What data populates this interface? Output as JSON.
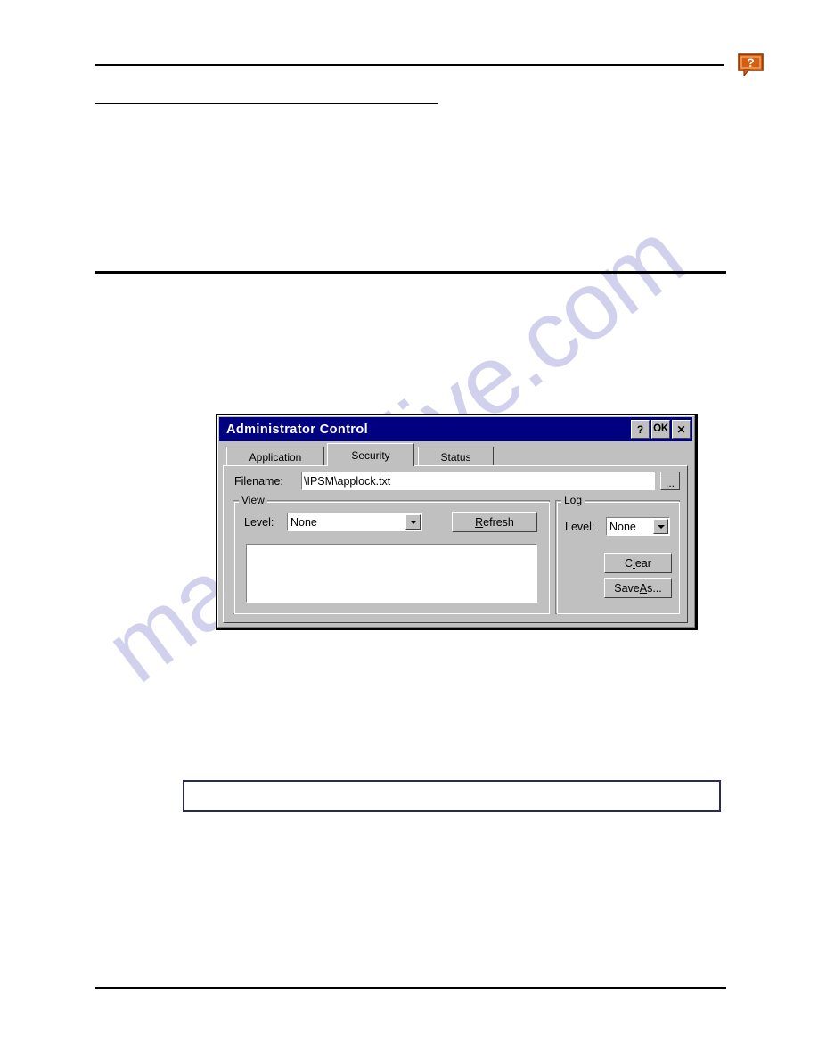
{
  "page": {
    "watermark_text": "manualslive.com",
    "help_icon": "question-mark-bubble-icon",
    "note_box_text": ""
  },
  "dialog": {
    "title": "Administrator Control",
    "titlebar_buttons": [
      {
        "name": "help",
        "label": "?"
      },
      {
        "name": "ok",
        "label": "OK"
      },
      {
        "name": "close",
        "label": "✕"
      }
    ],
    "tabs": [
      {
        "id": "application",
        "label": "Application",
        "active": false
      },
      {
        "id": "security",
        "label": "Security",
        "active": true
      },
      {
        "id": "status",
        "label": "Status",
        "active": false
      }
    ],
    "security_tab": {
      "filename": {
        "label": "Filename:",
        "value": "\\IPSM\\applock.txt",
        "placeholder": "",
        "browse_label": "..."
      },
      "view_group": {
        "legend": "View",
        "level_label": "Level:",
        "level_value": "None",
        "level_options": [
          "None"
        ],
        "refresh_button": {
          "prefix": "",
          "accel": "R",
          "suffix": "efresh"
        },
        "listbox_items": []
      },
      "log_group": {
        "legend": "Log",
        "level_label": "Level:",
        "level_value": "None",
        "level_options": [
          "None"
        ],
        "clear_button": {
          "prefix": "C",
          "accel": "l",
          "suffix": "ear"
        },
        "saveas_button": {
          "prefix": "Save ",
          "accel": "A",
          "suffix": "s..."
        }
      }
    }
  },
  "colors": {
    "titlebar": "#000080",
    "dialog_face": "#c0c0c0",
    "field_bg": "#ffffff",
    "watermark": "#c9c9ea",
    "help_icon_accent": "#d4600f",
    "note_border": "#2b2b55"
  }
}
